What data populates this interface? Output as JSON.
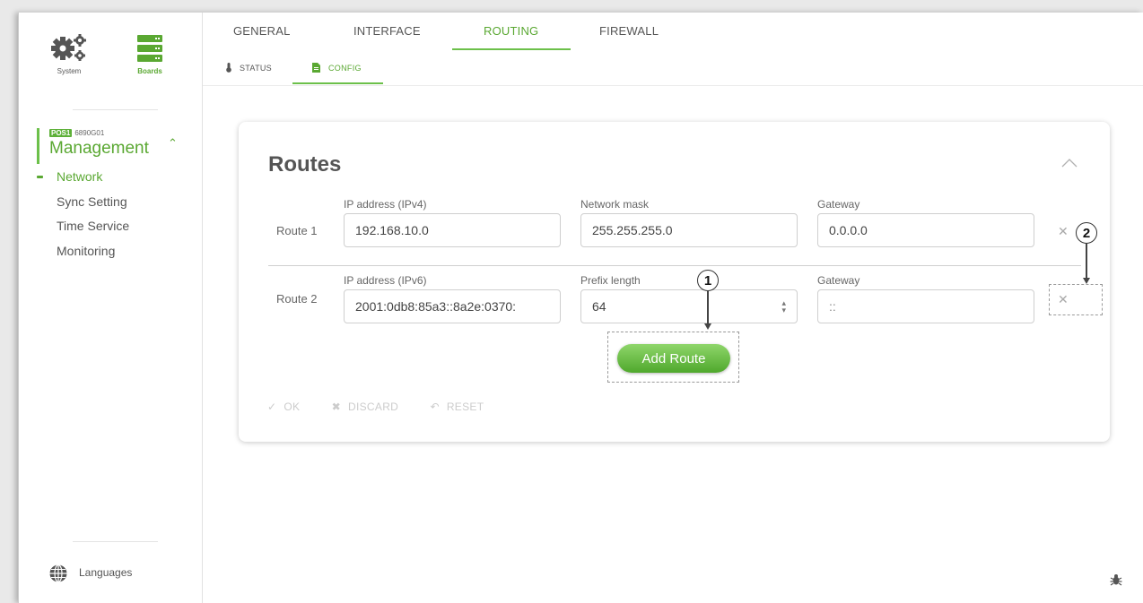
{
  "sidebar": {
    "top_icons": [
      {
        "label": "System",
        "icon": "gears-icon"
      },
      {
        "label": "Boards",
        "icon": "boards-icon"
      }
    ],
    "group": {
      "badge": "POS1",
      "code": "6890G01",
      "title": "Management",
      "expanded": true
    },
    "items": [
      {
        "label": "Network",
        "active": true
      },
      {
        "label": "Sync Setting"
      },
      {
        "label": "Time Service"
      },
      {
        "label": "Monitoring"
      }
    ],
    "languages_label": "Languages"
  },
  "tabs": [
    {
      "label": "GENERAL"
    },
    {
      "label": "INTERFACE"
    },
    {
      "label": "ROUTING",
      "active": true
    },
    {
      "label": "FIREWALL"
    }
  ],
  "subtabs": [
    {
      "label": "STATUS",
      "icon": "thermometer-icon"
    },
    {
      "label": "CONFIG",
      "icon": "document-icon",
      "active": true
    }
  ],
  "card": {
    "title": "Routes",
    "routes": [
      {
        "label": "Route 1",
        "ip_label": "IP address (IPv4)",
        "ip_value": "192.168.10.0",
        "mask_label": "Network mask",
        "mask_value": "255.255.255.0",
        "gateway_label": "Gateway",
        "gateway_value": "0.0.0.0"
      },
      {
        "label": "Route 2",
        "ip_label": "IP address (IPv6)",
        "ip_value": "2001:0db8:85a3::8a2e:0370:",
        "mask_label": "Prefix length",
        "mask_value": "64",
        "gateway_label": "Gateway",
        "gateway_value": "::"
      }
    ],
    "add_route_label": "Add Route",
    "actions": {
      "ok": "OK",
      "discard": "DISCARD",
      "reset": "RESET"
    }
  },
  "callouts": [
    "1",
    "2"
  ],
  "colors": {
    "accent": "#5aa832",
    "button_top": "#8fd66b",
    "button_bottom": "#4fa82c"
  }
}
